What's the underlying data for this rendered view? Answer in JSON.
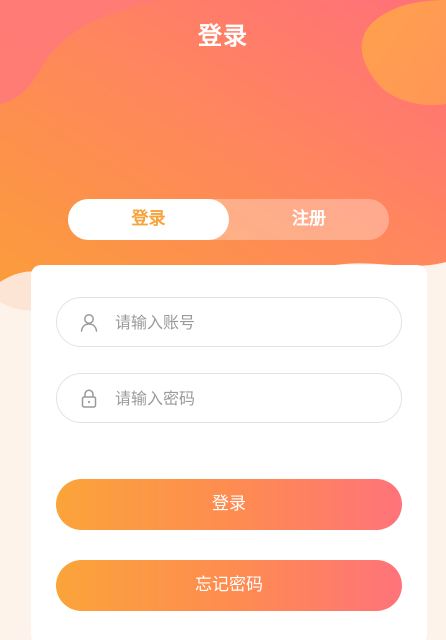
{
  "header": {
    "title": "登录"
  },
  "tabs": {
    "login": "登录",
    "register": "注册",
    "active": "login"
  },
  "form": {
    "username": {
      "placeholder": "请输入账号",
      "value": "",
      "icon": "user-icon"
    },
    "password": {
      "placeholder": "请输入密码",
      "value": "",
      "icon": "lock-icon"
    }
  },
  "buttons": {
    "login": "登录",
    "forgot": "忘记密码"
  },
  "colors": {
    "gradient_start": "#fba43a",
    "gradient_end": "#ff737a",
    "background": "#fdf3ea",
    "active_tab_text": "#f5a33a"
  }
}
